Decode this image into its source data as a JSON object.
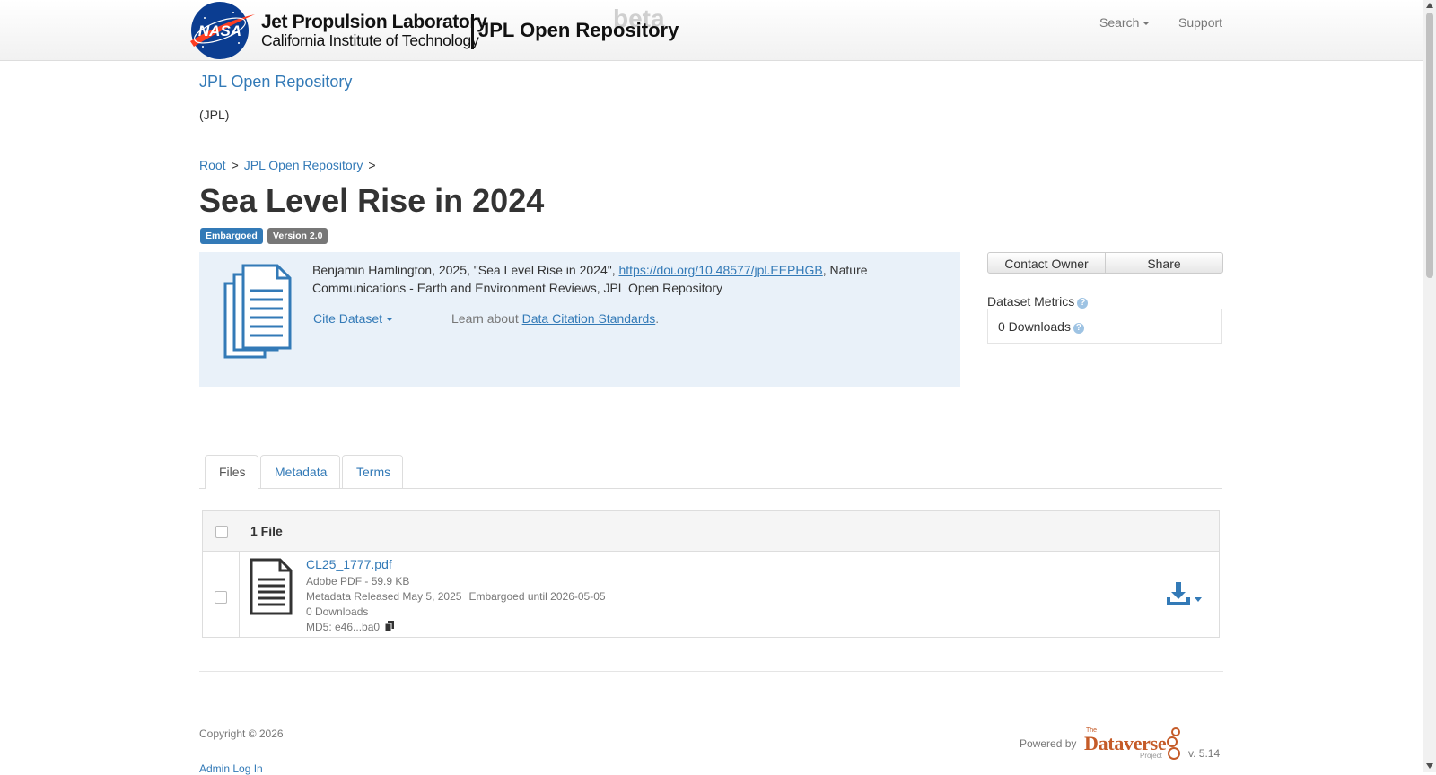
{
  "navbar": {
    "logo_alt": "NASA",
    "lab_name": "Jet Propulsion Laboratory",
    "lab_subtitle": "California Institute of Technology",
    "brand": "JPL Open Repository",
    "beta_tag": "beta",
    "search_label": "Search",
    "support_label": "Support"
  },
  "dataverse": {
    "name": "JPL Open Repository",
    "affiliation": "(JPL)"
  },
  "breadcrumb": {
    "items": [
      "Root",
      "JPL Open Repository"
    ],
    "separator": ">"
  },
  "dataset": {
    "title": "Sea Level Rise in 2024",
    "badge_embargoed": "Embargoed",
    "badge_version": "Version 2.0"
  },
  "citation": {
    "text_before": "Benjamin Hamlington, 2025, \"Sea Level Rise in 2024\", ",
    "doi_link": "https://doi.org/10.48577/jpl.EEPHGB",
    "text_after": ", Nature Communications - Earth and Environment Reviews, JPL Open Repository",
    "cite_dropdown": "Cite Dataset",
    "learn_prefix": "Learn about ",
    "learn_link": "Data Citation Standards",
    "learn_suffix": "."
  },
  "actions": {
    "contact_owner": "Contact Owner",
    "share": "Share"
  },
  "metrics": {
    "heading": "Dataset Metrics",
    "downloads": "0 Downloads",
    "help_glyph": "?"
  },
  "tabs": [
    {
      "label": "Files",
      "active": true
    },
    {
      "label": "Metadata",
      "active": false
    },
    {
      "label": "Terms",
      "active": false
    }
  ],
  "files": {
    "count_label": "1 File",
    "rows": [
      {
        "name": "CL25_1777.pdf",
        "type_size": "Adobe PDF - 59.9 KB",
        "released": "Metadata Released May 5, 2025",
        "embargo": "Embargoed until 2026-05-05",
        "downloads": "0 Downloads",
        "md5": "MD5: e46...ba0"
      }
    ]
  },
  "footer": {
    "copyright": "Copyright © 2026",
    "admin_login": "Admin Log In",
    "powered_by": "Powered by",
    "dv_the": "The",
    "dv_word": "Dataverse",
    "dv_project": "Project",
    "version": "v. 5.14"
  },
  "colors": {
    "link": "#337ab7",
    "embargo_badge": "#337ab7",
    "version_badge": "#777777",
    "citation_bg": "#e9f1f9",
    "dataverse_brand": "#c55b28"
  }
}
